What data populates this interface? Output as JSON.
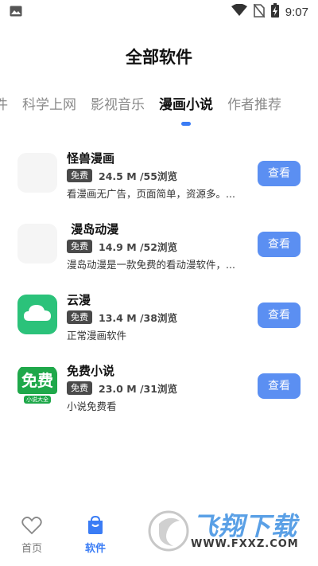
{
  "status_bar": {
    "time": "9:07",
    "left_icon": "image-icon",
    "right_icons": [
      "wifi-icon",
      "no-sim-icon",
      "battery-charging-icon"
    ]
  },
  "page": {
    "title": "全部软件"
  },
  "tabs": [
    {
      "label": "件",
      "active": false
    },
    {
      "label": "科学上网",
      "active": false
    },
    {
      "label": "影视音乐",
      "active": false
    },
    {
      "label": "漫画小说",
      "active": true
    },
    {
      "label": "作者推荐",
      "active": false
    }
  ],
  "apps": [
    {
      "name": "怪兽漫画",
      "badge": "免费",
      "size": "24.5 M /55浏览",
      "desc": "看漫画无广告，页面简单，资源多。...",
      "button": "查看",
      "icon": "blank-icon"
    },
    {
      "name": " 漫岛动漫",
      "badge": "免费",
      "size": "14.9 M /52浏览",
      "desc": "漫岛动漫是一款免费的看动漫软件，...",
      "button": "查看",
      "icon": "blank-icon"
    },
    {
      "name": "云漫",
      "badge": "免费",
      "size": "13.4 M /38浏览",
      "desc": "正常漫画软件",
      "button": "查看",
      "icon": "cloud-icon"
    },
    {
      "name": "免费小说",
      "badge": "免费",
      "size": "23.0 M /31浏览",
      "desc": "小说免费看",
      "button": "查看",
      "icon": "free-novel-icon",
      "icon_text_main": "免费",
      "icon_text_sub": "小说大全"
    }
  ],
  "bottom_nav": {
    "home_label": "首页",
    "software_label": "软件"
  },
  "watermark": {
    "text": "飞翔下载",
    "url": "WWW.FXXZ.COM"
  },
  "colors": {
    "accent": "#3a7cf5",
    "button": "#5b8ff2",
    "cloud_app": "#2bc27a",
    "novel_app": "#1fa84a"
  }
}
